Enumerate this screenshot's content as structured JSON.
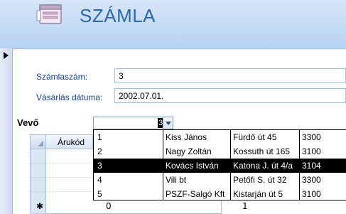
{
  "header": {
    "title": "SZÁMLA",
    "icon": "form-icon"
  },
  "fields": {
    "szamlaszam": {
      "label": "Számlaszám:",
      "value": "3"
    },
    "vasarlas_datuma": {
      "label": "Vásárlás dátuma:",
      "value": "2002.07.01."
    },
    "vevo": {
      "label": "Vevő",
      "value": "3"
    }
  },
  "subform": {
    "column_header": "Árukód",
    "new_row_values": [
      "0",
      "1"
    ]
  },
  "dropdown": {
    "selected_index": 2,
    "rows": [
      [
        "1",
        "Kiss János",
        "Fürdő út 45",
        "3300"
      ],
      [
        "2",
        "Nagy Zoltán",
        "Kossuth út 165",
        "3100"
      ],
      [
        "3",
        "Kovács István",
        "Katona J. út 4/a",
        "3104"
      ],
      [
        "4",
        "Vili bt",
        "Petőfi S. út 32",
        "3300"
      ],
      [
        "5",
        "PSZF-Salgó Kft",
        "Kistarján út 5",
        "3100"
      ]
    ]
  },
  "colors": {
    "accent": "#2e67b1",
    "label": "#15428b",
    "selection": "#000000"
  }
}
